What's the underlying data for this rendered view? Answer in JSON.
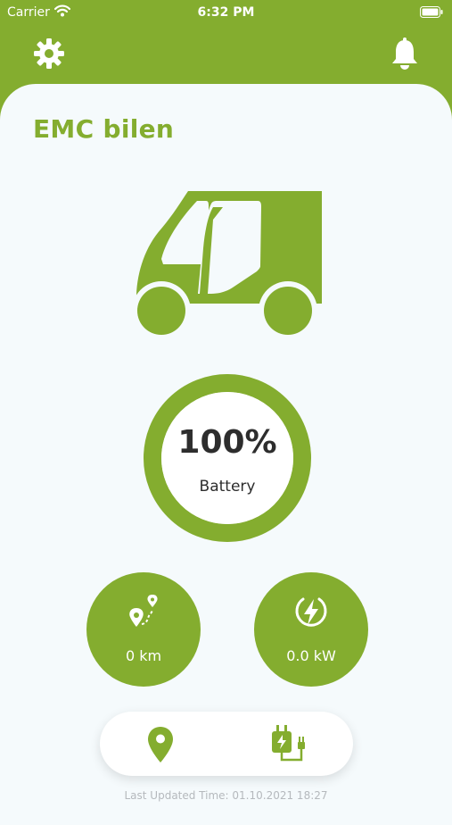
{
  "status_bar": {
    "carrier": "Carrier",
    "time": "6:32 PM"
  },
  "header": {
    "settings_icon": "gear-icon",
    "notifications_icon": "bell-icon"
  },
  "vehicle": {
    "name": "EMC bilen",
    "image": "electric-van-icon"
  },
  "battery": {
    "percent_text": "100%",
    "label": "Battery",
    "level": 1.0
  },
  "stats": {
    "distance": {
      "icon": "route-pins-icon",
      "value": "0 km"
    },
    "power": {
      "icon": "lightning-icon",
      "value": "0.0 kW"
    }
  },
  "bottom_nav": {
    "map_icon": "map-pin-icon",
    "charge_icon": "charging-plug-icon"
  },
  "footer": {
    "last_updated": "Last Updated Time: 01.10.2021 18:27"
  },
  "colors": {
    "brand_green": "#84ad2f",
    "card_bg": "#f5fafc",
    "text_dark": "#2d2d2d"
  }
}
